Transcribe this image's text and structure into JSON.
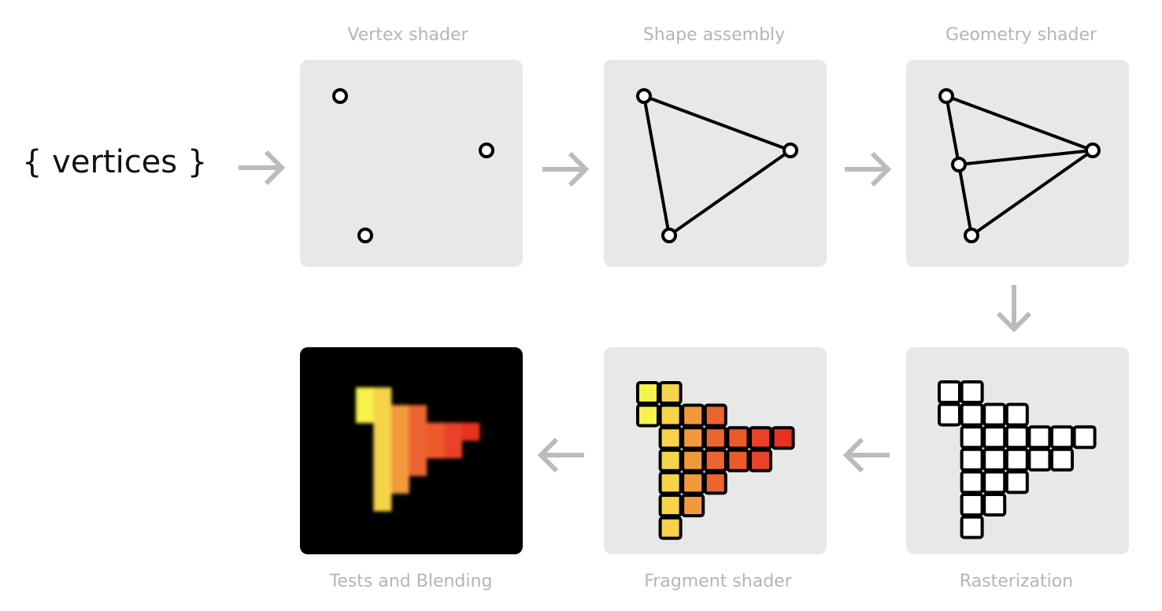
{
  "input_label": "{ vertices }",
  "stages": {
    "vertex_shader": "Vertex shader",
    "shape_assembly": "Shape assembly",
    "geometry_shader": "Geometry shader",
    "rasterization": "Rasterization",
    "fragment_shader": "Fragment shader",
    "tests_blending": "Tests and Blending"
  },
  "colors": {
    "panel": "#e8e8e8",
    "arrow": "#bbbbbb",
    "label": "#b5b5b5",
    "fragment_columns": [
      "#f8f24c",
      "#f7d34a",
      "#f29a3a",
      "#ec6430",
      "#ec5a2c",
      "#e8432a",
      "#e8321f"
    ]
  },
  "raster_rows": [
    [
      0,
      1
    ],
    [
      0,
      1,
      2,
      3
    ],
    [
      1,
      2,
      3,
      4,
      5,
      6
    ],
    [
      1,
      2,
      3,
      4,
      5
    ],
    [
      1,
      2,
      3
    ],
    [
      1,
      2
    ],
    [
      1
    ]
  ]
}
